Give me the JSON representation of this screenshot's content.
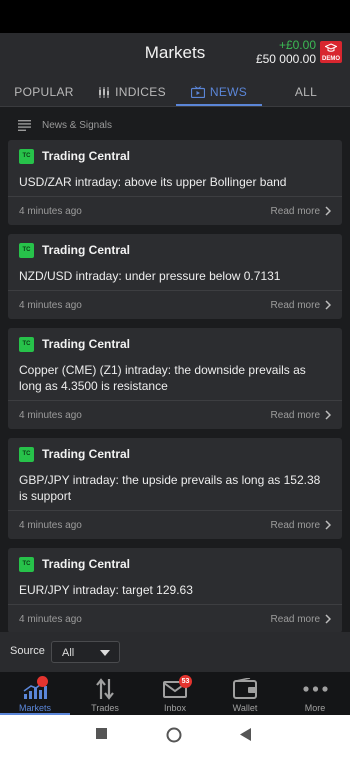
{
  "header": {
    "title": "Markets",
    "balance_change": "+£0.00",
    "balance_total": "£50 000.00",
    "demo_label": "DEMO"
  },
  "tabs": [
    {
      "label": "POPULAR",
      "icon": "",
      "active": false
    },
    {
      "label": "INDICES",
      "icon": "candlestick-icon",
      "active": false
    },
    {
      "label": "NEWS",
      "icon": "tv-icon",
      "active": true
    },
    {
      "label": "ALL",
      "icon": "",
      "active": false
    }
  ],
  "section": {
    "title": "News & Signals",
    "icon": "list-icon"
  },
  "cards": [
    {
      "source_badge": "TC",
      "source": "Trading Central",
      "text": "USD/ZAR intraday: above its upper Bollinger band",
      "time": "4 minutes ago",
      "more": "Read more"
    },
    {
      "source_badge": "TC",
      "source": "Trading Central",
      "text": "NZD/USD intraday: under pressure below 0.7131",
      "time": "4 minutes ago",
      "more": "Read more"
    },
    {
      "source_badge": "TC",
      "source": "Trading Central",
      "text": "Copper (CME) (Z1) intraday: the downside prevails as long as 4.3500 is resistance",
      "time": "4 minutes ago",
      "more": "Read more"
    },
    {
      "source_badge": "TC",
      "source": "Trading Central",
      "text": "GBP/JPY intraday: the upside prevails as long as 152.38 is support",
      "time": "4 minutes ago",
      "more": "Read more"
    },
    {
      "source_badge": "TC",
      "source": "Trading Central",
      "text": "EUR/JPY intraday: target 129.63",
      "time": "4 minutes ago",
      "more": "Read more"
    }
  ],
  "filter": {
    "label": "Source",
    "selected": "All"
  },
  "nav": [
    {
      "label": "Markets",
      "icon": "markets-chart-icon",
      "active": true
    },
    {
      "label": "Trades",
      "icon": "trades-arrows-icon",
      "active": false
    },
    {
      "label": "Inbox",
      "icon": "inbox-envelope-icon",
      "active": false,
      "badge": "53"
    },
    {
      "label": "Wallet",
      "icon": "wallet-icon",
      "active": false
    },
    {
      "label": "More",
      "icon": "more-dots-icon",
      "active": false
    }
  ],
  "colors": {
    "accent": "#5b86d8",
    "positive": "#3cba54",
    "demo": "#d8262f",
    "source_badge": "#27c24a"
  }
}
